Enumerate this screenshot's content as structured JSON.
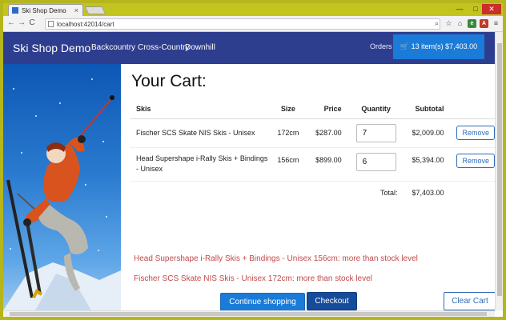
{
  "browser": {
    "tab_title": "Ski Shop Demo",
    "url": "localhost:42014/cart",
    "back_glyph": "←",
    "forward_glyph": "→",
    "reload_glyph": "C",
    "home_glyph": "⌂",
    "close_tab_glyph": "×",
    "window_minimize_glyph": "—",
    "window_maximize_glyph": "□",
    "window_close_glyph": "✕"
  },
  "navbar": {
    "brand": "Ski Shop Demo",
    "links": [
      "Backcountry",
      "Cross-Country",
      "Downhill"
    ],
    "orders": "Orders",
    "cart_icon": "shopping-cart-icon",
    "cart_summary": "13 item(s) $7,403.00"
  },
  "cart": {
    "title": "Your Cart:",
    "headers": {
      "skis": "Skis",
      "size": "Size",
      "price": "Price",
      "quantity": "Quantity",
      "subtotal": "Subtotal"
    },
    "items": [
      {
        "name": "Fischer SCS Skate NIS Skis - Unisex",
        "size": "172cm",
        "price": "$287.00",
        "quantity": "7",
        "subtotal": "$2,009.00",
        "remove": "Remove"
      },
      {
        "name": "Head Supershape i-Rally Skis + Bindings - Unisex",
        "size": "156cm",
        "price": "$899.00",
        "quantity": "6",
        "subtotal": "$5,394.00",
        "remove": "Remove"
      }
    ],
    "total_label": "Total:",
    "total_value": "$7,403.00"
  },
  "warnings": [
    "Head Supershape i-Rally Skis + Bindings - Unisex 156cm: more than stock level",
    "Fischer SCS Skate NIS Skis - Unisex 172cm: more than stock level"
  ],
  "buttons": {
    "continue": "Continue shopping",
    "checkout": "Checkout",
    "clear": "Clear Cart"
  },
  "colors": {
    "navbar": "#2e3e8e",
    "primary": "#1b7bd8",
    "dark_primary": "#154b9a",
    "warning": "#c24a4a"
  }
}
